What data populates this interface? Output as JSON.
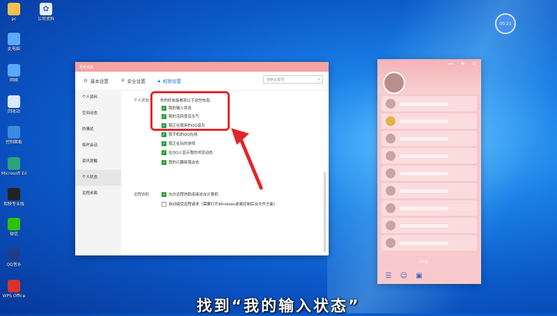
{
  "desktop": {
    "icons": [
      {
        "label": "pc",
        "icon": "folder-icon",
        "color": "#f2c14e"
      },
      {
        "label": "此电脑",
        "icon": "computer-icon",
        "color": "#5aa9ff"
      },
      {
        "label": "网络",
        "icon": "network-icon",
        "color": "#5aa9ff"
      },
      {
        "label": "回收站",
        "icon": "recycle-bin-icon",
        "color": "#d9e8ff"
      },
      {
        "label": "控制面板",
        "icon": "control-panel-icon",
        "color": "#3d8be0"
      },
      {
        "label": "Microsoft Edge",
        "icon": "edge-icon",
        "color": "#2aa37a"
      },
      {
        "label": "剪映专业版",
        "icon": "capcut-icon",
        "color": "#222222"
      },
      {
        "label": "微信",
        "icon": "wechat-icon",
        "color": "#2dc100"
      },
      {
        "label": "QQ音乐",
        "icon": "qq-music-icon",
        "color": "#1e3c8c"
      },
      {
        "label": "WPS Office",
        "icon": "wps-icon",
        "color": "#d9332b"
      }
    ],
    "top_icon2_label": "公司资料",
    "clock_text": "00:21"
  },
  "settings_window": {
    "title": "系统设置",
    "tabs": [
      {
        "label": "基本设置",
        "icon": "gear-icon"
      },
      {
        "label": "安全设置",
        "icon": "shield-icon"
      },
      {
        "label": "权限设置",
        "icon": "lock-icon"
      }
    ],
    "search_placeholder": "搜索设置项",
    "nav": [
      "个人资料",
      "空间动态",
      "防骚扰",
      "临时会话",
      "资讯提醒",
      "个人状态",
      "远程桌面"
    ],
    "sections": {
      "status_label": "个人状态",
      "status_intro": "你的好友能看到以下这些信息:",
      "status_options": [
        "我的输入状态",
        "我的活跃度及天气",
        "我正在使用的QQ音乐",
        "我手机的QQ在线",
        "我正在玩的游戏",
        "在QQ上显示我的浏览动态",
        "我的兴趣部落动态"
      ],
      "remote_label": "远程协助",
      "remote_options": [
        {
          "text": "允许远程协助连接这台计算机",
          "checked": true
        },
        {
          "text": "自动接受远程请求（需要打开Windows桌面控制后台文件方能）",
          "checked": false
        }
      ]
    }
  },
  "qq_panel": {
    "footer_text": "(共享)"
  },
  "subtitle": "找到“我的输入状态”"
}
